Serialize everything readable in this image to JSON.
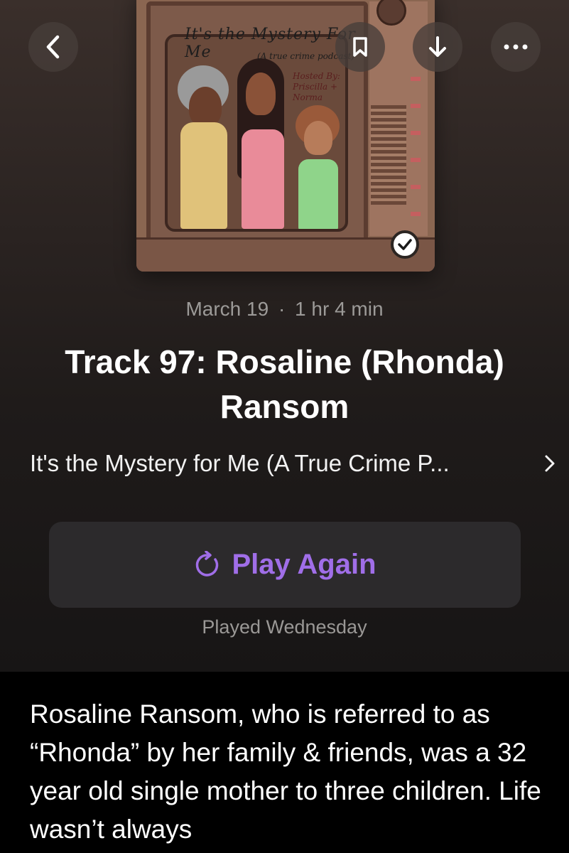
{
  "header": {
    "back_icon": "chevron-left-icon",
    "bookmark_icon": "bookmark-icon",
    "download_icon": "download-arrow-icon",
    "more_icon": "ellipsis-icon"
  },
  "artwork": {
    "title": "It's the Mystery For Me",
    "subtitle": "(A true crime podcast)",
    "hosts": "Hosted By: Priscilla + Norma",
    "played_badge_icon": "checkmark-icon"
  },
  "episode": {
    "date": "March 19",
    "separator": "·",
    "duration": "1 hr 4 min",
    "title": "Track 97: Rosaline (Rhonda) Ransom",
    "show_name": "It's the Mystery for Me (A True Crime P...",
    "show_chevron": "›"
  },
  "play": {
    "label": "Play Again",
    "icon": "replay-icon",
    "played_status": "Played Wednesday"
  },
  "description": "Rosaline Ransom,  who is referred to as “Rhonda” by her family & friends, was a 32 year old single mother to three children. Life wasn’t always",
  "colors": {
    "accent": "#a06ee8",
    "background": "#000000",
    "button_bg": "#2c2a2c"
  }
}
